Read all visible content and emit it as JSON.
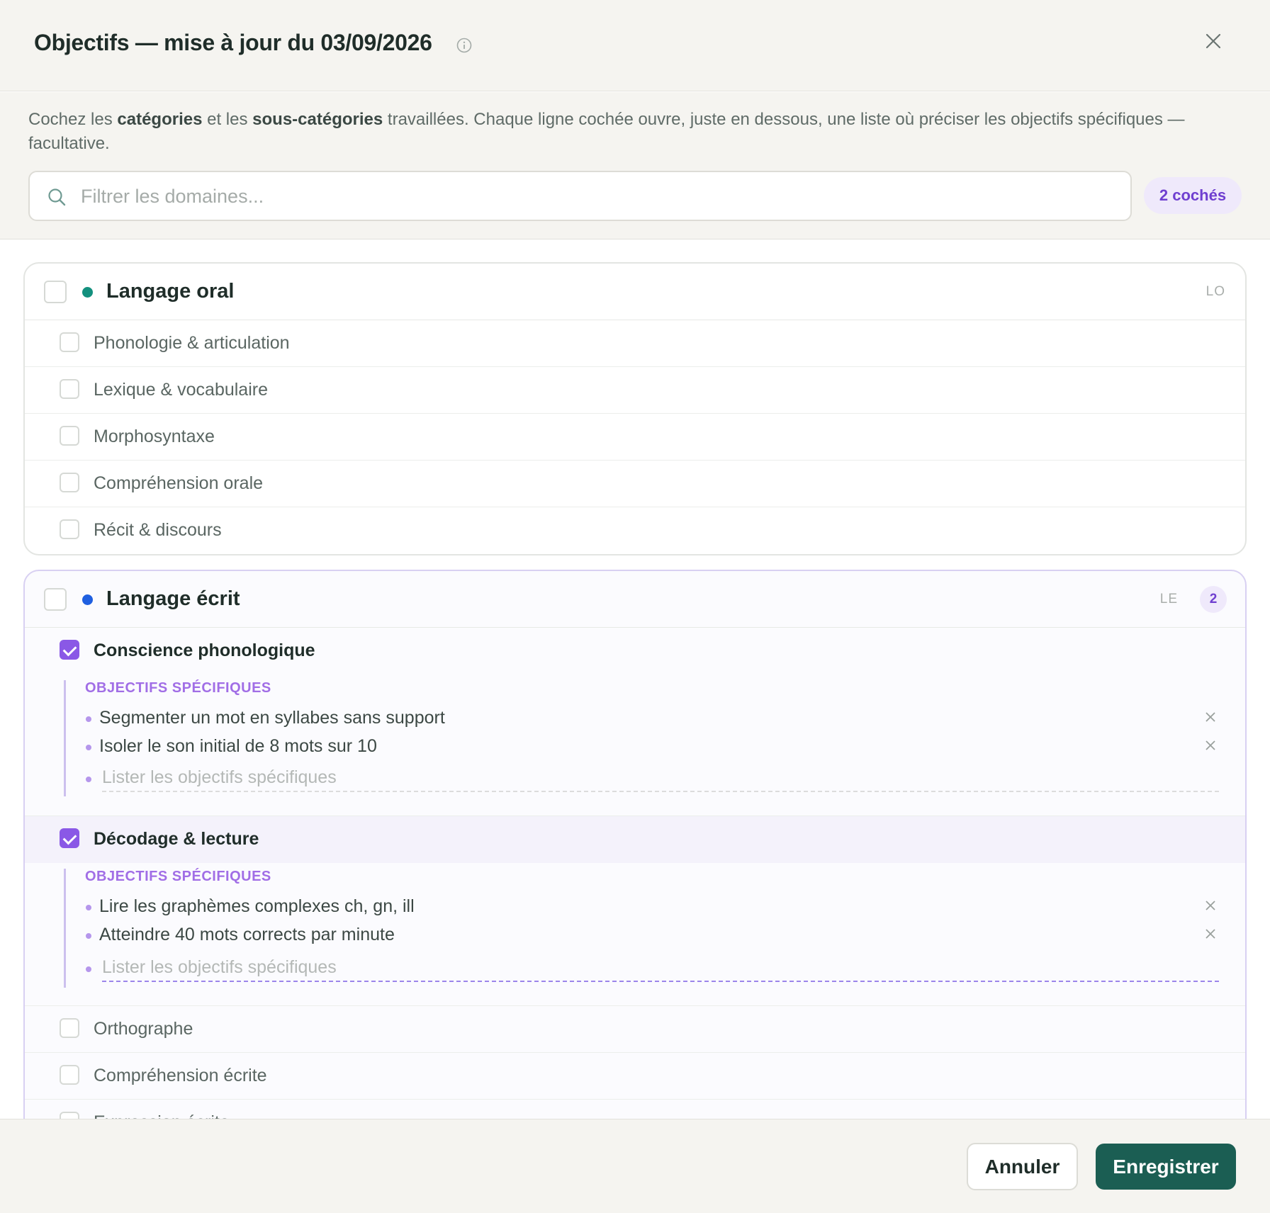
{
  "header": {
    "title": "Objectifs — mise à jour du 03/09/2026",
    "info_icon": "info-circle-icon",
    "close_icon": "close-icon"
  },
  "intro": {
    "part1": "Cochez les ",
    "bold1": "catégories",
    "part2": " et les ",
    "bold2": "sous-catégories",
    "part3": " travaillées. Chaque ligne cochée ouvre, juste en dessous, une liste où préciser les objectifs spécifiques — facultative."
  },
  "search": {
    "placeholder": "Filtrer les domaines...",
    "value": ""
  },
  "checked_count": "2 cochés",
  "colors": {
    "accent_purple": "#8a58e6",
    "primary_green": "#1b5e53",
    "oral_dot": "#13907e",
    "ecrit_dot": "#1f5fe0"
  },
  "domains": [
    {
      "title": "Langage oral",
      "code": "LO",
      "checked": false,
      "items": [
        {
          "label": "Phonologie & articulation",
          "checked": false
        },
        {
          "label": "Lexique & vocabulaire",
          "checked": false
        },
        {
          "label": "Morphosyntaxe",
          "checked": false
        },
        {
          "label": "Compréhension orale",
          "checked": false
        },
        {
          "label": "Récit & discours",
          "checked": false
        }
      ]
    },
    {
      "title": "Langage écrit",
      "code": "LE",
      "badge": "2",
      "checked": false,
      "items": [
        {
          "label": "Conscience phonologique",
          "checked": true,
          "objectives_heading": "OBJECTIFS SPÉCIFIQUES",
          "objectives": [
            "Segmenter un mot en syllabes sans support",
            "Isoler le son initial de 8 mots sur 10"
          ],
          "objective_placeholder": "Lister les objectifs spécifiques"
        },
        {
          "label": "Décodage & lecture",
          "checked": true,
          "objectives_heading": "OBJECTIFS SPÉCIFIQUES",
          "objectives": [
            "Lire les graphèmes complexes ch, gn, ill",
            "Atteindre 40 mots corrects par minute"
          ],
          "objective_placeholder": "Lister les objectifs spécifiques"
        },
        {
          "label": "Orthographe",
          "checked": false
        },
        {
          "label": "Compréhension écrite",
          "checked": false
        },
        {
          "label": "Expression écrite",
          "checked": false
        }
      ]
    }
  ],
  "footer": {
    "cancel_label": "Annuler",
    "save_label": "Enregistrer"
  }
}
